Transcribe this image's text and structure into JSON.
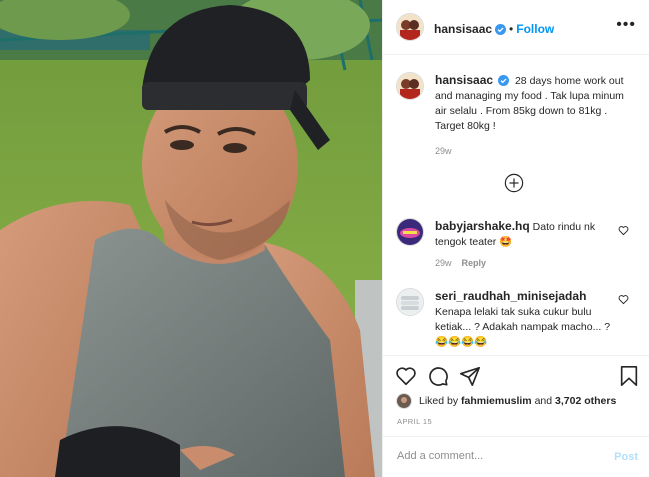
{
  "post": {
    "username": "hansisaac",
    "follow_label": "Follow",
    "separator": "•",
    "more_label": "•••",
    "caption": "28 days home work out and managing my food . Tak lupa minum air selalu . From 85kg down to 81kg . Target 80kg !",
    "caption_time": "29w",
    "likes_prefix": "Liked by",
    "liked_by_user": "fahmiemuslim",
    "likes_and": "and",
    "likes_others": "3,702 others",
    "date": "APRIL 15"
  },
  "comments": [
    {
      "username": "babyjarshake.hq",
      "text": "Dato rindu nk tengok teater 🤩",
      "time": "29w",
      "reply_label": "Reply"
    },
    {
      "username": "seri_raudhah_minisejadah",
      "text": "Kenapa lelaki tak suka cukur bulu ketiak... ? Adakah nampak macho... ? 😂😂😂😂"
    }
  ],
  "composer": {
    "placeholder": "Add a comment...",
    "post_label": "Post"
  },
  "icons": {
    "verified": "verified-badge-icon",
    "like": "heart-icon",
    "comment": "comment-bubble-icon",
    "share": "paper-plane-icon",
    "save": "bookmark-icon",
    "load_more": "plus-circle-icon"
  },
  "colors": {
    "link": "#0095f6",
    "muted": "#8e8e8e",
    "post_disabled": "#b2dffc"
  }
}
